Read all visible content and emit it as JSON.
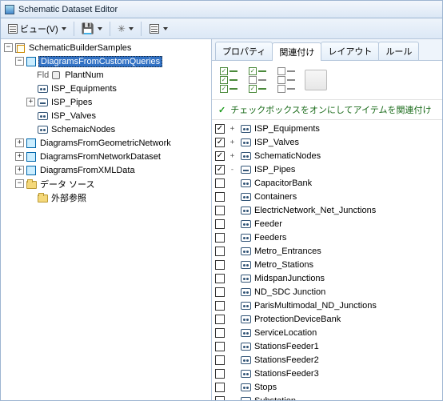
{
  "window": {
    "title": "Schematic Dataset Editor"
  },
  "toolbar": {
    "view_label": "ビュー(V)",
    "save_title": "保存",
    "tool3_title": "関連付け",
    "tool4_title": "ツリー"
  },
  "tree": {
    "root": "SchematicBuilderSamples",
    "n_custom": "DiagramsFromCustomQueries",
    "fld": "Fld",
    "fld_plant": "PlantNum",
    "isp_eq": "ISP_Equipments",
    "isp_pipes": "ISP_Pipes",
    "isp_valves": "ISP_Valves",
    "schem_nodes": "SchemaicNodes",
    "n_geo": "DiagramsFromGeometricNetwork",
    "n_net": "DiagramsFromNetworkDataset",
    "n_xml": "DiagramsFromXMLData",
    "datasource": "データ ソース",
    "extref": "外部参照"
  },
  "tabs": {
    "t1": "プロパティ",
    "t2": "関連付け",
    "t3": "レイアウト",
    "t4": "ルール"
  },
  "hint": "チェックボックスをオンにしてアイテムを関連付け",
  "items": [
    {
      "label": "ISP_Equipments",
      "checked": true,
      "exp": "+",
      "kind": "dots"
    },
    {
      "label": "ISP_Valves",
      "checked": true,
      "exp": "+",
      "kind": "dots"
    },
    {
      "label": "SchematicNodes",
      "checked": true,
      "exp": "+",
      "kind": "dots"
    },
    {
      "label": "ISP_Pipes",
      "checked": true,
      "exp": "-",
      "kind": "line"
    },
    {
      "label": "CapacitorBank",
      "checked": false,
      "exp": "",
      "kind": "dots"
    },
    {
      "label": "Containers",
      "checked": false,
      "exp": "",
      "kind": "dots"
    },
    {
      "label": "ElectricNetwork_Net_Junctions",
      "checked": false,
      "exp": "",
      "kind": "dots"
    },
    {
      "label": "Feeder",
      "checked": false,
      "exp": "",
      "kind": "dots"
    },
    {
      "label": "Feeders",
      "checked": false,
      "exp": "",
      "kind": "dots"
    },
    {
      "label": "Metro_Entrances",
      "checked": false,
      "exp": "",
      "kind": "dots"
    },
    {
      "label": "Metro_Stations",
      "checked": false,
      "exp": "",
      "kind": "dots"
    },
    {
      "label": "MidspanJunctions",
      "checked": false,
      "exp": "",
      "kind": "dots"
    },
    {
      "label": "ND_SDC Junction",
      "checked": false,
      "exp": "",
      "kind": "dots"
    },
    {
      "label": "ParisMultimodal_ND_Junctions",
      "checked": false,
      "exp": "",
      "kind": "dots"
    },
    {
      "label": "ProtectionDeviceBank",
      "checked": false,
      "exp": "",
      "kind": "dots"
    },
    {
      "label": "ServiceLocation",
      "checked": false,
      "exp": "",
      "kind": "dots"
    },
    {
      "label": "StationsFeeder1",
      "checked": false,
      "exp": "",
      "kind": "dots"
    },
    {
      "label": "StationsFeeder2",
      "checked": false,
      "exp": "",
      "kind": "dots"
    },
    {
      "label": "StationsFeeder3",
      "checked": false,
      "exp": "",
      "kind": "dots"
    },
    {
      "label": "Stops",
      "checked": false,
      "exp": "",
      "kind": "dots"
    },
    {
      "label": "Substation",
      "checked": false,
      "exp": "",
      "kind": "dots"
    }
  ]
}
